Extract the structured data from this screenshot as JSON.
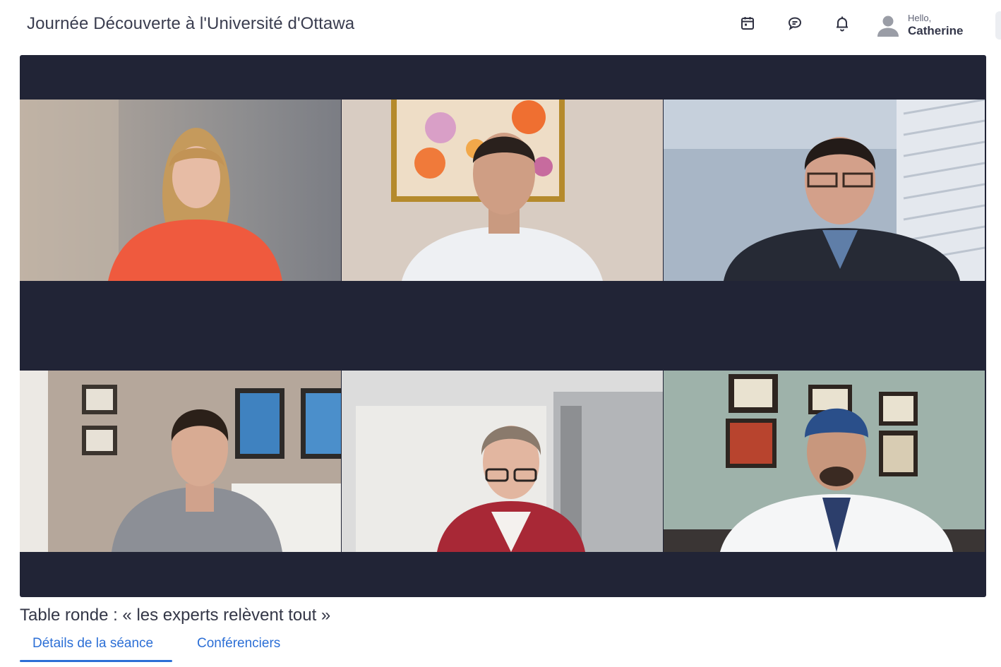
{
  "header": {
    "title": "Journée Découverte à l'Université d'Ottawa",
    "icons": [
      "calendar-icon",
      "chat-icon",
      "bell-icon"
    ],
    "user": {
      "greeting": "Hello,",
      "name": "Catherine",
      "avatar_icon": "user-avatar-icon"
    }
  },
  "video_grid": {
    "columns": 3,
    "rows": 2,
    "background_color": "#212436",
    "participants": [
      {
        "position": "top-left",
        "description": "woman in coral top"
      },
      {
        "position": "top-center",
        "description": "man in light patterned shirt"
      },
      {
        "position": "top-right",
        "description": "man in dark jacket with glasses"
      },
      {
        "position": "bottom-left",
        "description": "man in grey fleece"
      },
      {
        "position": "bottom-center",
        "description": "woman in red blazer with glasses"
      },
      {
        "position": "bottom-right",
        "description": "doctor in white coat and surgical cap"
      }
    ]
  },
  "session": {
    "title": "Table ronde : « les experts relèvent tout »",
    "tabs": [
      {
        "label": "Détails de la séance",
        "active": true
      },
      {
        "label": "Conférenciers",
        "active": false
      }
    ]
  },
  "colors": {
    "accent": "#2c6fd6",
    "text": "#343747",
    "stage": "#212436"
  }
}
